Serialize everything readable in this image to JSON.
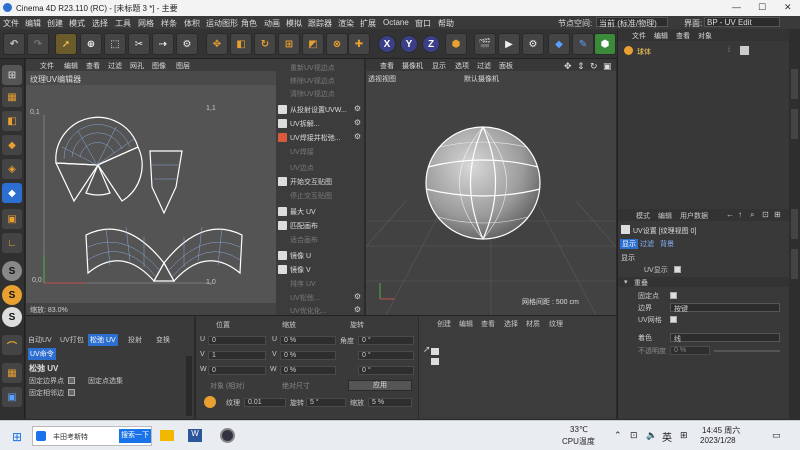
{
  "window": {
    "title": "Cinema 4D R23.110 (RC) - [未标题 3 *] - 主要",
    "min": "—",
    "max": "☐",
    "close": "✕"
  },
  "menubar": {
    "items": [
      "文件",
      "编辑",
      "创建",
      "模式",
      "选择",
      "工具",
      "网格",
      "样条",
      "体积",
      "运动图形",
      "角色",
      "动画",
      "模拟",
      "跟踪器",
      "渲染",
      "扩展",
      "Octane",
      "窗口",
      "帮助"
    ],
    "node_space_label": "节点空间:",
    "node_space_value": "当前 (标准/物理)",
    "interface_label": "界面:",
    "interface_value": "BP - UV Edit"
  },
  "toolbar": {
    "axis_x": "X",
    "axis_y": "Y",
    "axis_z": "Z"
  },
  "uv_editor": {
    "menu": [
      "文件",
      "编辑",
      "查看",
      "过滤",
      "网孔",
      "图像",
      "图层"
    ],
    "title": "纹理UV编辑器",
    "label_top_left": "0,1",
    "label_top_right": "1,1",
    "label_bottom_left": "0,0",
    "label_bottom_right": "1,0",
    "zoom": "缩放: 83.0%"
  },
  "uv_commands": [
    {
      "label": "重新UV视边点",
      "enabled": false
    },
    {
      "label": "移除UV视边点",
      "enabled": false
    },
    {
      "label": "清除UV视边点",
      "enabled": false
    },
    {
      "label": "从投射设置UVW...",
      "enabled": true,
      "gear": true
    },
    {
      "label": "UV拆解...",
      "enabled": true,
      "gear": true
    },
    {
      "label": "UV焊接并松弛...",
      "enabled": true,
      "gear": true
    },
    {
      "label": "UV焊接",
      "enabled": false
    },
    {
      "label": "UV边点",
      "enabled": false
    },
    {
      "label": "开始交互贴图",
      "enabled": true
    },
    {
      "label": "停止交互贴图",
      "enabled": false
    },
    {
      "label": "最大 UV",
      "enabled": true
    },
    {
      "label": "匹配画布",
      "enabled": true
    },
    {
      "label": "适合画布",
      "enabled": false
    },
    {
      "label": "镜像 U",
      "enabled": true
    },
    {
      "label": "镜像 V",
      "enabled": true
    },
    {
      "label": "排序 UV",
      "enabled": false
    },
    {
      "label": "UV松弛...",
      "enabled": false,
      "gear": true
    },
    {
      "label": "UV优化化...",
      "enabled": false,
      "gear": true
    }
  ],
  "viewport": {
    "menu": [
      "查看",
      "摄像机",
      "显示",
      "选项",
      "过滤",
      "面板"
    ],
    "name": "透视视图",
    "camera": "默认摄像机",
    "grid_spacing": "网格间距 : 500 cm"
  },
  "object_manager": {
    "menu": [
      "文件",
      "编辑",
      "查看",
      "对象"
    ],
    "object_name": "球体"
  },
  "attributes": {
    "menu": [
      "模式",
      "编辑",
      "用户数据"
    ],
    "title": "UV设置 [纹理视图 0]",
    "tabs": [
      "显示",
      "过滤",
      "背景"
    ],
    "section": "显示",
    "uv_display_label": "UV显示",
    "group": "重叠",
    "fixed_point_label": "固定点",
    "border_label": "边界",
    "border_value": "按键",
    "uv_mesh_label": "UV网格",
    "color_label": "着色",
    "color_value": "线",
    "opacity_label": "不透明度",
    "opacity_value": "0 %"
  },
  "uv_relax_panel": {
    "tabs": [
      "自动UV",
      "UV打包",
      "松弛 UV",
      "投射",
      "变换"
    ],
    "subtab": "UV命令",
    "title": "松弛 UV",
    "pin_border": "固定边界点",
    "pin_points": "固定点选集",
    "cut_edges": "固定相邻边"
  },
  "coordinates": {
    "headers": [
      "位置",
      "缩放",
      "旋转"
    ],
    "rows": [
      {
        "axis": "U",
        "pos": "0",
        "scale_axis": "U",
        "scale": "0 %",
        "rot_label": "角度",
        "rot": "0 °"
      },
      {
        "axis": "V",
        "pos": "1",
        "scale_axis": "V",
        "scale": "0 %",
        "rot_label": "",
        "rot": "0 °"
      },
      {
        "axis": "W",
        "pos": "0",
        "scale_axis": "W",
        "scale": "0 %",
        "rot_label": "",
        "rot": "0 °"
      }
    ],
    "mode_left": "对象 (相对)",
    "mode_right": "绝对尺寸",
    "apply": "应用",
    "texture_label": "纹理",
    "texture_value": "0.01",
    "rotate_label": "旋转",
    "rotate_value": "5 °",
    "scale_label": "缩放",
    "scale_value": "5 %"
  },
  "material": {
    "menu": [
      "创建",
      "编辑",
      "查看",
      "选择",
      "材质",
      "纹理"
    ]
  },
  "taskbar": {
    "search_text": "丰田考斯特",
    "search_button": "搜索一下",
    "temperature": "33℃",
    "temp_label": "CPU温度",
    "ime": "英",
    "time": "14:45 周六",
    "date": "2023/1/28"
  },
  "colors": {
    "accent_blue": "#3a3f88",
    "orange": "#e8a030",
    "uv_line": "#ffffff",
    "selection": "#2d6fd1"
  }
}
